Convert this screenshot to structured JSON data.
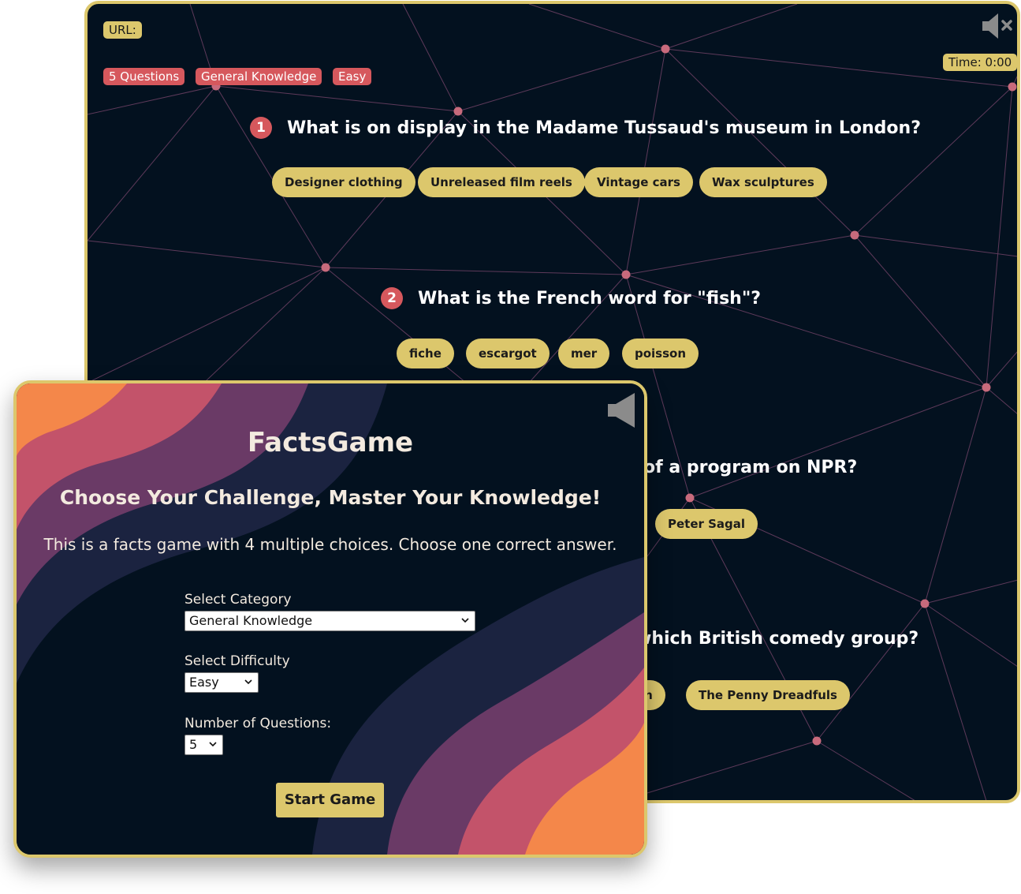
{
  "quiz": {
    "url_label": "URL:",
    "tags": [
      "5 Questions",
      "General Knowledge",
      "Easy"
    ],
    "timer": "Time: 0:00",
    "mute_icon": "speaker-muted-icon",
    "questions": [
      {
        "number": "1",
        "text": "What is on display in the Madame Tussaud's museum in London?",
        "answers": [
          "Designer clothing",
          "Unreleased film reels",
          "Vintage cars",
          "Wax sculptures"
        ]
      },
      {
        "number": "2",
        "text": "What is the French word for \"fish\"?",
        "answers": [
          "fiche",
          "escargot",
          "mer",
          "poisson"
        ]
      },
      {
        "text_visible": "of a program on NPR?",
        "answer_visible": "Peter Sagal"
      },
      {
        "text_visible": "which British comedy group?",
        "answers_visible": [
          "en",
          "The Penny Dreadfuls"
        ]
      }
    ],
    "colors": {
      "background": "#03111f",
      "border": "#dcc76c",
      "accent": "#d6585d",
      "network_line": "#5e3a5a",
      "network_node": "#c86a7c"
    }
  },
  "menu": {
    "title": "FactsGame",
    "subtitle": "Choose Your Challenge, Master Your Knowledge!",
    "description": "This is a facts game with 4 multiple choices. Choose one correct answer.",
    "category_label": "Select Category",
    "category_value": "General Knowledge",
    "difficulty_label": "Select Difficulty",
    "difficulty_value": "Easy",
    "questions_label": "Number of Questions:",
    "questions_value": "5",
    "start_label": "Start Game",
    "sound_icon": "speaker-icon",
    "colors": {
      "orange": "#f4874a",
      "pink": "#c3536a",
      "purple": "#6a3a66",
      "navy": "#1b2340",
      "background": "#03111f"
    }
  }
}
